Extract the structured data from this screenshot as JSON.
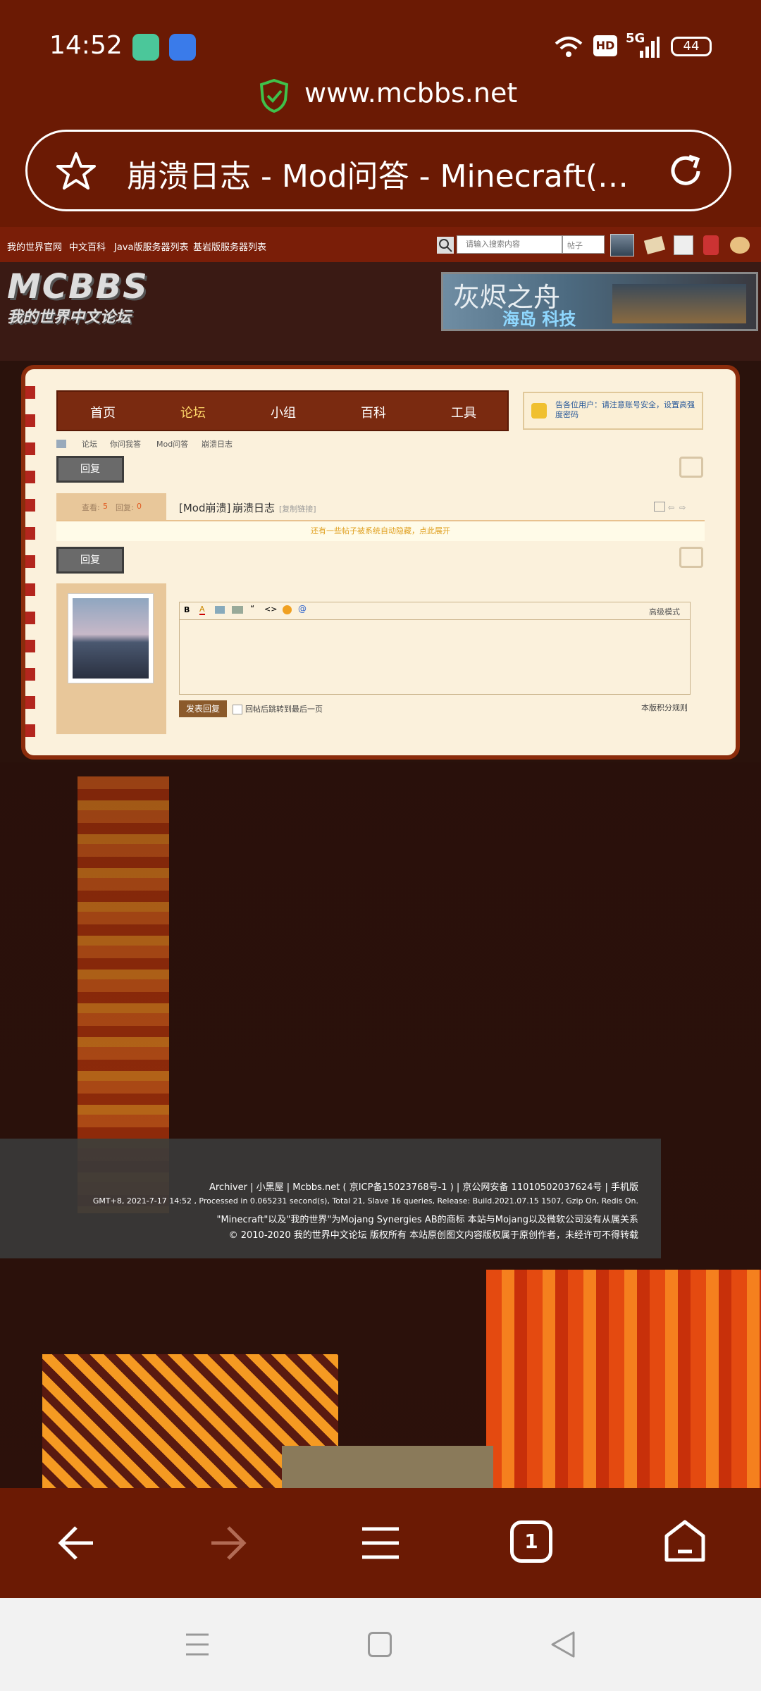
{
  "status_bar": {
    "time": "14:52",
    "battery": "44",
    "signal": "5G",
    "hd": "HD"
  },
  "browser": {
    "url": "www.mcbbs.net",
    "title": "崩溃日志 - Mod问答 - Minecraft(我…",
    "tab_count": "1"
  },
  "top_links": [
    "我的世界官网",
    "中文百科",
    "Java版服务器列表",
    "基岩版服务器列表"
  ],
  "search": {
    "placeholder": "请输入搜索内容",
    "scope": "帖子"
  },
  "banner": {
    "line1": "灰烬之舟",
    "line2": "海岛  科技"
  },
  "logo_text": "MCBBS 我的世界中文论坛",
  "nav": [
    "首页",
    "论坛",
    "小组",
    "百科",
    "工具"
  ],
  "notice": "告各位用户：请注意账号安全，设置高强度密码",
  "breadcrumb": [
    "论坛",
    "你问我答",
    "Mod问答",
    "崩溃日志"
  ],
  "reply_label": "回复",
  "thread": {
    "views_label": "查看:",
    "views": "5",
    "replies_label": "回复:",
    "replies": "0",
    "prefix": "[Mod崩溃]",
    "title": "崩溃日志",
    "copy_link": "[复制链接]"
  },
  "hidden_notice": "还有一些帖子被系统自动隐藏，点此展开",
  "editor": {
    "advanced": "高级模式",
    "submit": "发表回复",
    "jump_label": "回帖后跳转到最后一页",
    "rules": "本版积分规则"
  },
  "footer": {
    "line1": "Archiver | 小黑屋 | Mcbbs.net ( 京ICP备15023768号-1 ) | 京公网安备 11010502037624号 | 手机版",
    "line2": "GMT+8, 2021-7-17 14:52 , Processed in 0.065231 second(s), Total 21, Slave 16 queries, Release: Build.2021.07.15 1507, Gzip On, Redis On.",
    "line3": "\"Minecraft\"以及\"我的世界\"为Mojang Synergies AB的商标 本站与Mojang以及微软公司没有从属关系",
    "line4": "© 2010-2020 我的世界中文论坛 版权所有 本站原创图文内容版权属于原创作者，未经许可不得转载"
  }
}
